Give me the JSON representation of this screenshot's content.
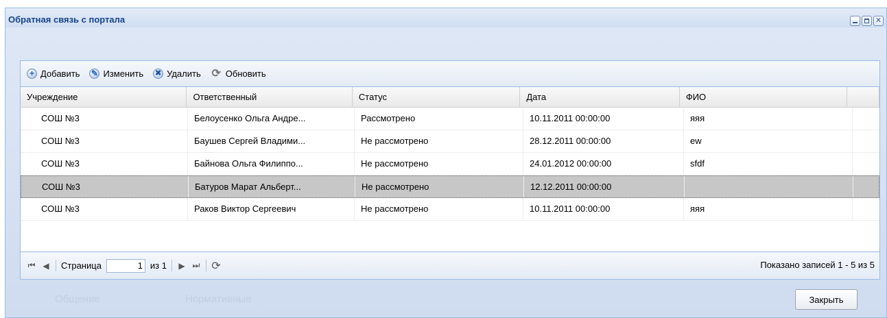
{
  "window": {
    "title": "Обратная связь с портала"
  },
  "toolbar": {
    "add": "Добавить",
    "edit": "Изменить",
    "delete": "Удалить",
    "refresh": "Обновить"
  },
  "grid": {
    "columns": [
      "Учреждение",
      "Ответственный",
      "Статус",
      "Дата",
      "ФИО"
    ],
    "rows": [
      {
        "institution": "СОШ №3",
        "responsible": "Белоусенко Ольга Андре...",
        "status": "Рассмотрено",
        "date": "10.11.2011 00:00:00",
        "fio": "яяя",
        "selected": false
      },
      {
        "institution": "СОШ №3",
        "responsible": "Баушев Сергей Владими...",
        "status": "Не рассмотрено",
        "date": "28.12.2011 00:00:00",
        "fio": "ew",
        "selected": false
      },
      {
        "institution": "СОШ №3",
        "responsible": "Байнова Ольга Филиппо...",
        "status": "Не рассмотрено",
        "date": "24.01.2012 00:00:00",
        "fio": "sfdf",
        "selected": false
      },
      {
        "institution": "СОШ №3",
        "responsible": "Батуров Марат Альберт...",
        "status": "Не рассмотрено",
        "date": "12.12.2011 00:00:00",
        "fio": "",
        "selected": true
      },
      {
        "institution": "СОШ №3",
        "responsible": "Раков Виктор Сергеевич",
        "status": "Не рассмотрено",
        "date": "10.11.2011 00:00:00",
        "fio": "яяя",
        "selected": false
      }
    ]
  },
  "pager": {
    "page_label": "Страница",
    "page_value": "1",
    "of_label": "из 1",
    "summary": "Показано записей 1 - 5 из 5"
  },
  "background": {
    "label1": "Общение",
    "label2": "Нормативные"
  },
  "buttons": {
    "close": "Закрыть"
  },
  "colors": {
    "window_border": "#99bbe8",
    "title_text": "#15428b",
    "selected_row": "#c7c7c7"
  }
}
